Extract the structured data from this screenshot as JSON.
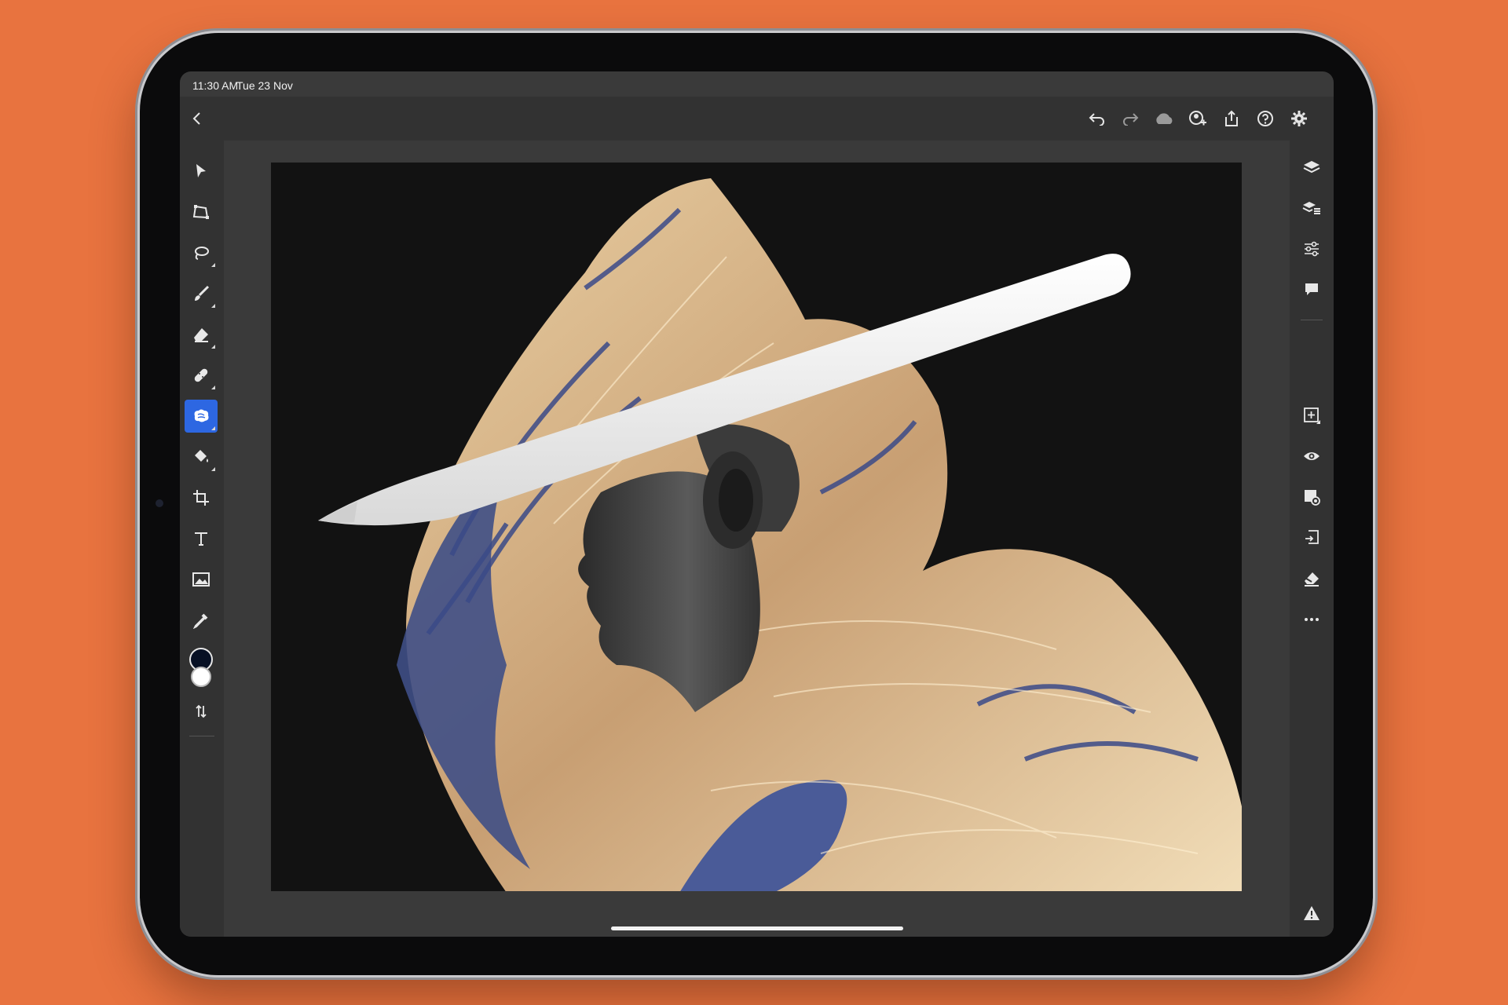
{
  "status": {
    "time": "11:30 AM",
    "date": "Tue 23 Nov"
  },
  "toolbar": {
    "icons": [
      "back-chevron-icon",
      "undo-icon",
      "redo-icon",
      "cloud-icon",
      "invite-user-icon",
      "share-icon",
      "help-icon",
      "settings-gear-icon"
    ]
  },
  "left_tools": [
    "select",
    "transform",
    "lasso-select",
    "brush",
    "eraser",
    "healing",
    "quick-select-blob",
    "fill-bucket",
    "crop",
    "type",
    "place-image",
    "eyedropper"
  ],
  "colors": {
    "foreground": "#071024",
    "background": "#ffffff",
    "accent": "#2d67e2",
    "page_bg": "#e8733f"
  },
  "right_tools": [
    "layers",
    "layer-properties",
    "adjustments",
    "comments",
    "add-layer",
    "visibility",
    "mask",
    "import",
    "eraser-mask",
    "more",
    "warning"
  ],
  "canvas": {
    "subject": "profile portrait with betta fish fins, stylus overlay"
  }
}
